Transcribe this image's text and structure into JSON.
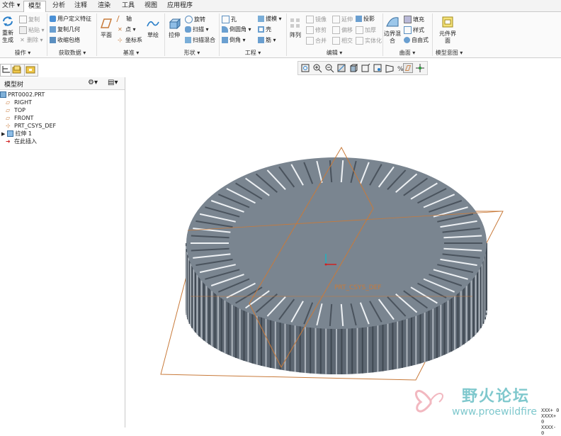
{
  "menubar": {
    "file": "文件 ▾",
    "tabs": [
      "模型",
      "分析",
      "注释",
      "渲染",
      "工具",
      "视图",
      "应用程序"
    ]
  },
  "ribbon": {
    "regenerate": "重新生成",
    "copy": "复制",
    "paste": "粘贴",
    "delete": "删除",
    "user_feature": "用户定义特征",
    "copy_geometry": "复制几何",
    "shrinkwrap": "收缩包络",
    "plane": "平面",
    "axis": "轴",
    "point": "点",
    "coord_sys": "坐标系",
    "sketch": "草绘",
    "extrude": "拉伸",
    "revolve": "旋转",
    "sweep": "扫描",
    "swept_blend": "扫描混合",
    "hole": "孔",
    "round": "倒圆角",
    "chamfer": "倒角",
    "draft": "拔模",
    "shell": "壳",
    "rib": "筋",
    "pattern": "阵列",
    "mirror": "镜像",
    "trim": "修剪",
    "merge": "合并",
    "extend": "延伸",
    "offset": "偏移",
    "intersect": "相交",
    "project": "投影",
    "thicken": "加厚",
    "solidify": "实体化",
    "boundary_blend": "边界混合",
    "fill": "填充",
    "style": "样式",
    "freestyle": "自由式",
    "component_interface": "元件界面",
    "groups": {
      "operations": "操作 ▾",
      "get_data": "获取数据 ▾",
      "datum": "基准 ▾",
      "shapes": "形状 ▾",
      "engineering": "工程 ▾",
      "editing": "编辑 ▾",
      "surfaces": "曲面 ▾",
      "model_intent": "模型意图 ▾"
    }
  },
  "tree": {
    "header": "模型树",
    "items": [
      "PRT0002.PRT",
      "RIGHT",
      "TOP",
      "FRONT",
      "PRT_CSYS_DEF",
      "拉伸 1",
      "在此插入"
    ]
  },
  "viewport": {
    "csys_label": "PRT_CSYS_DEF"
  },
  "watermark": {
    "title": "野火论坛",
    "url": "www.proewildfire"
  },
  "corner": {
    "lines": [
      "XXX+ 0",
      "XXXX+ 0",
      "XXXX- 0"
    ]
  },
  "colors": {
    "model_fill": "#7a8590",
    "model_dark": "#5d6772",
    "datum_orange": "#c87a3a",
    "watermark": "#7fc8cd"
  }
}
